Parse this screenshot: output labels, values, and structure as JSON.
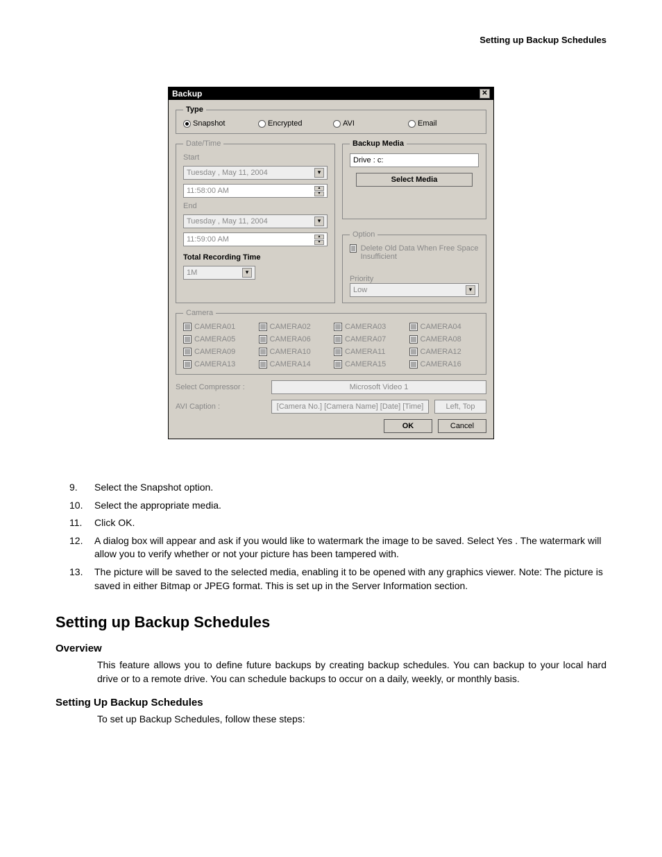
{
  "header": {
    "title": "Setting up Backup Schedules"
  },
  "dialog": {
    "title": "Backup",
    "type": {
      "legend": "Type",
      "options": [
        "Snapshot",
        "Encrypted",
        "AVI",
        "Email"
      ],
      "selected": 0
    },
    "datetime": {
      "legend": "Date/Time",
      "start_label": "Start",
      "start_date": "Tuesday  ,    May    11, 2004",
      "start_time": "11:58:00 AM",
      "end_label": "End",
      "end_date": "Tuesday  ,    May    11, 2004",
      "end_time": "11:59:00 AM",
      "total_label": "Total Recording Time",
      "total_value": "1M"
    },
    "media": {
      "legend": "Backup Media",
      "drive": "Drive : c:",
      "select_btn": "Select Media"
    },
    "option": {
      "legend": "Option",
      "delete_label": "Delete Old Data When Free Space Insufficient",
      "priority_label": "Priority",
      "priority_value": "Low"
    },
    "camera": {
      "legend": "Camera",
      "items": [
        "CAMERA01",
        "CAMERA02",
        "CAMERA03",
        "CAMERA04",
        "CAMERA05",
        "CAMERA06",
        "CAMERA07",
        "CAMERA08",
        "CAMERA09",
        "CAMERA10",
        "CAMERA11",
        "CAMERA12",
        "CAMERA13",
        "CAMERA14",
        "CAMERA15",
        "CAMERA16"
      ]
    },
    "compressor": {
      "label": "Select Compressor :",
      "value": "Microsoft Video 1"
    },
    "caption": {
      "label": "AVI Caption :",
      "value": "[Camera No.] [Camera Name] [Date] [Time]",
      "pos": "Left, Top"
    },
    "buttons": {
      "ok": "OK",
      "cancel": "Cancel"
    }
  },
  "steps": [
    {
      "n": "9.",
      "t": "Select the Snapshot option."
    },
    {
      "n": "10.",
      "t": "Select the appropriate media."
    },
    {
      "n": "11.",
      "t": "Click OK."
    },
    {
      "n": "12.",
      "t": "A dialog box will appear and ask if you would like to watermark the image to be saved. Select Yes . The watermark will allow you to verify whether or not your picture has been tampered with."
    },
    {
      "n": "13.",
      "t": "The picture will be saved to the selected media, enabling it to be opened with any graphics viewer. Note: The picture is saved in either Bitmap or JPEG format. This is set up in the Server Information section."
    }
  ],
  "section": {
    "title": "Setting up Backup Schedules",
    "overview_h": "Overview",
    "overview_t": "This feature allows you to define future backups by creating backup schedules. You can backup to your local hard drive or to a remote drive. You can schedule backups to occur on a daily, weekly, or monthly basis.",
    "setting_h": "Setting Up Backup Schedules",
    "setting_t": "To set up Backup Schedules, follow these steps:"
  }
}
